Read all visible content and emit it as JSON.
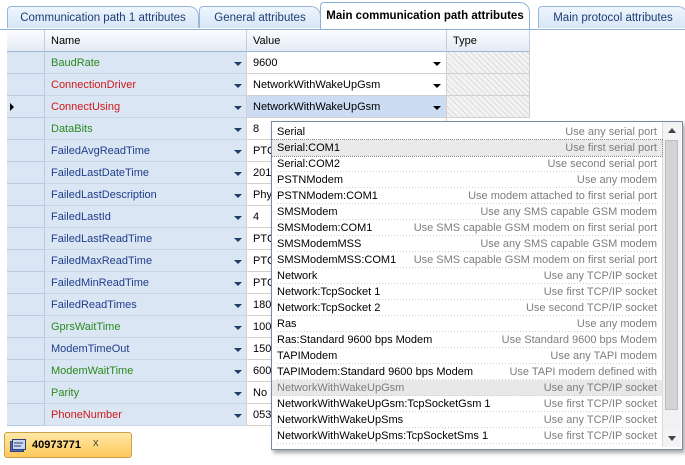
{
  "tabs": [
    {
      "label": "Communication path 1 attributes",
      "active": false
    },
    {
      "label": "General attributes",
      "active": false
    },
    {
      "label": "Main communication path attributes",
      "active": true
    },
    {
      "label": "Main protocol attributes",
      "active": false
    }
  ],
  "grid": {
    "headers": {
      "name": "Name",
      "value": "Value",
      "type": "Type"
    },
    "rows": [
      {
        "name": "BaudRate",
        "name_color": "#2a8a1f",
        "value": "9600",
        "dropdown": true
      },
      {
        "name": "ConnectionDriver",
        "name_color": "#d01818",
        "value": "NetworkWithWakeUpGsm",
        "dropdown": true
      },
      {
        "name": "ConnectUsing",
        "name_color": "#d01818",
        "value": "NetworkWithWakeUpGsm",
        "dropdown": true,
        "selected": true
      },
      {
        "name": "DataBits",
        "name_color": "#2a8a1f",
        "value": "8"
      },
      {
        "name": "FailedAvgReadTime",
        "name_color": "#1f3d8a",
        "value": "PTC"
      },
      {
        "name": "FailedLastDateTime",
        "name_color": "#1f3d8a",
        "value": "201"
      },
      {
        "name": "FailedLastDescription",
        "name_color": "#1f3d8a",
        "value": "Phy"
      },
      {
        "name": "FailedLastId",
        "name_color": "#1f3d8a",
        "value": "4"
      },
      {
        "name": "FailedLastReadTime",
        "name_color": "#1f3d8a",
        "value": "PTC"
      },
      {
        "name": "FailedMaxReadTime",
        "name_color": "#1f3d8a",
        "value": "PTC"
      },
      {
        "name": "FailedMinReadTime",
        "name_color": "#1f3d8a",
        "value": "PTC"
      },
      {
        "name": "FailedReadTimes",
        "name_color": "#1f3d8a",
        "value": "180"
      },
      {
        "name": "GprsWaitTime",
        "name_color": "#2a8a1f",
        "value": "100"
      },
      {
        "name": "ModemTimeOut",
        "name_color": "#1f3d8a",
        "value": "150"
      },
      {
        "name": "ModemWaitTime",
        "name_color": "#2a8a1f",
        "value": "600"
      },
      {
        "name": "Parity",
        "name_color": "#2a8a1f",
        "value": "No"
      },
      {
        "name": "PhoneNumber",
        "name_color": "#d01818",
        "value": "053"
      }
    ]
  },
  "dropdown_list": [
    {
      "name": "Serial",
      "desc": "Use any serial port"
    },
    {
      "name": "Serial:COM1",
      "desc": "Use first serial port",
      "state": "focus"
    },
    {
      "name": "Serial:COM2",
      "desc": "Use second serial port"
    },
    {
      "name": "PSTNModem",
      "desc": "Use any modem"
    },
    {
      "name": "PSTNModem:COM1",
      "desc": "Use modem attached to first serial port"
    },
    {
      "name": "SMSModem",
      "desc": "Use any SMS capable GSM modem"
    },
    {
      "name": "SMSModem:COM1",
      "desc": "Use SMS capable GSM modem on first serial port"
    },
    {
      "name": "SMSModemMSS",
      "desc": "Use any SMS capable GSM modem"
    },
    {
      "name": "SMSModemMSS:COM1",
      "desc": "Use SMS capable GSM modem on first serial port"
    },
    {
      "name": "Network",
      "desc": "Use any TCP/IP socket"
    },
    {
      "name": "Network:TcpSocket 1",
      "desc": "Use first TCP/IP socket"
    },
    {
      "name": "Network:TcpSocket 2",
      "desc": "Use second TCP/IP socket"
    },
    {
      "name": "Ras",
      "desc": "Use any modem"
    },
    {
      "name": "Ras:Standard  9600 bps Modem",
      "desc": "Use Standard 9600 bps Modem"
    },
    {
      "name": "TAPIModem",
      "desc": "Use any TAPI modem"
    },
    {
      "name": "TAPIModem:Standard  9600 bps Modem",
      "desc": "Use TAPI modem defined with"
    },
    {
      "name": "NetworkWithWakeUpGsm",
      "desc": "Use any TCP/IP socket",
      "state": "highlight"
    },
    {
      "name": "NetworkWithWakeUpGsm:TcpSocketGsm 1",
      "desc": "Use first TCP/IP socket"
    },
    {
      "name": "NetworkWithWakeUpSms",
      "desc": "Use any TCP/IP socket"
    },
    {
      "name": "NetworkWithWakeUpSms:TcpSocketSms 1",
      "desc": "Use first TCP/IP socket"
    }
  ],
  "document_tab": {
    "label": "40973771",
    "close": "x",
    "icon": "document-icon"
  }
}
